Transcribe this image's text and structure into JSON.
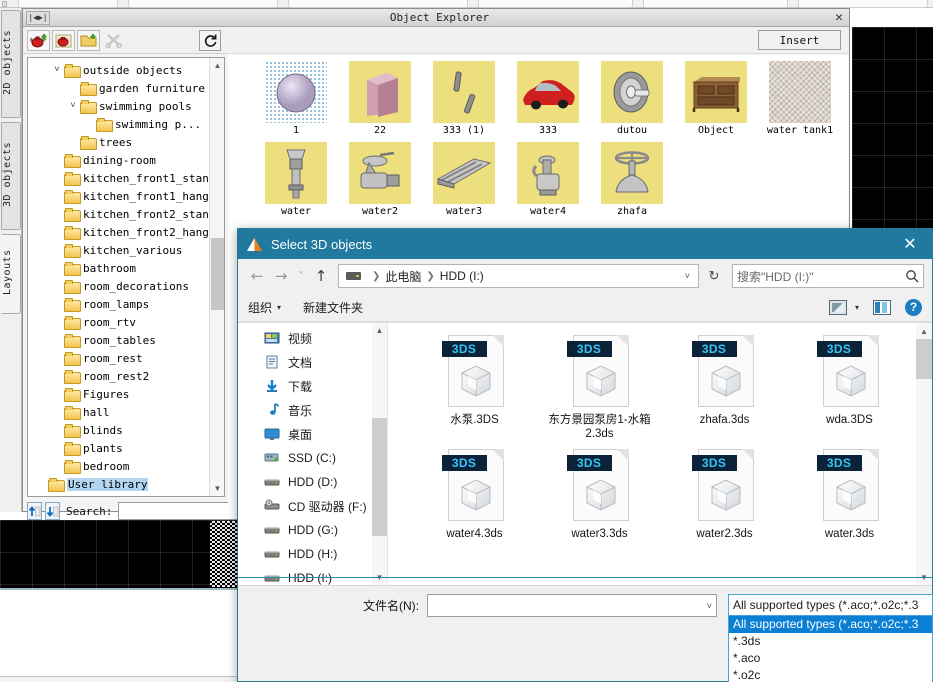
{
  "app": {
    "vertical_tabs": [
      {
        "label": "2D objects",
        "active": false
      },
      {
        "label": "3D objects",
        "active": false
      },
      {
        "label": "Layouts",
        "active": true
      }
    ]
  },
  "object_explorer": {
    "title": "Object Explorer",
    "close_label": "✕",
    "grip_label": "|◀▶|",
    "insert_label": "Insert",
    "toolbar": [
      {
        "name": "add-object-icon",
        "glyph": "🫖",
        "disabled": false
      },
      {
        "name": "edit-object-icon",
        "glyph": "🫖",
        "disabled": false
      },
      {
        "name": "new-folder-icon",
        "glyph": "📁",
        "disabled": false
      },
      {
        "name": "tools-icon",
        "glyph": "✂",
        "disabled": true
      },
      {
        "name": "refresh-icon",
        "glyph": "↻",
        "disabled": false
      }
    ],
    "tree": [
      {
        "label": "outside objects",
        "indent": 1,
        "arrow": "˅",
        "selected": false
      },
      {
        "label": "garden furniture",
        "indent": 2,
        "arrow": "",
        "selected": false
      },
      {
        "label": "swimming pools",
        "indent": 2,
        "arrow": "˅",
        "selected": false
      },
      {
        "label": "swimming p...",
        "indent": 3,
        "arrow": "",
        "selected": false
      },
      {
        "label": "trees",
        "indent": 2,
        "arrow": "",
        "selected": false
      },
      {
        "label": "dining-room",
        "indent": 1,
        "arrow": "",
        "selected": false
      },
      {
        "label": "kitchen_front1_stand",
        "indent": 1,
        "arrow": "",
        "selected": false
      },
      {
        "label": "kitchen_front1_hang",
        "indent": 1,
        "arrow": "",
        "selected": false
      },
      {
        "label": "kitchen_front2_stand",
        "indent": 1,
        "arrow": "",
        "selected": false
      },
      {
        "label": "kitchen_front2_hang",
        "indent": 1,
        "arrow": "",
        "selected": false
      },
      {
        "label": "kitchen_various",
        "indent": 1,
        "arrow": "",
        "selected": false
      },
      {
        "label": "bathroom",
        "indent": 1,
        "arrow": "",
        "selected": false
      },
      {
        "label": "room_decorations",
        "indent": 1,
        "arrow": "",
        "selected": false
      },
      {
        "label": "room_lamps",
        "indent": 1,
        "arrow": "",
        "selected": false
      },
      {
        "label": "room_rtv",
        "indent": 1,
        "arrow": "",
        "selected": false
      },
      {
        "label": "room_tables",
        "indent": 1,
        "arrow": "",
        "selected": false
      },
      {
        "label": "room_rest",
        "indent": 1,
        "arrow": "",
        "selected": false
      },
      {
        "label": "room_rest2",
        "indent": 1,
        "arrow": "",
        "selected": false
      },
      {
        "label": "Figures",
        "indent": 1,
        "arrow": "",
        "selected": false
      },
      {
        "label": "hall",
        "indent": 1,
        "arrow": "",
        "selected": false
      },
      {
        "label": "blinds",
        "indent": 1,
        "arrow": "",
        "selected": false
      },
      {
        "label": "plants",
        "indent": 1,
        "arrow": "",
        "selected": false
      },
      {
        "label": "bedroom",
        "indent": 1,
        "arrow": "",
        "selected": false
      },
      {
        "label": "User library",
        "indent": 0,
        "arrow": "",
        "selected": true
      }
    ],
    "search": {
      "label": "Search:",
      "value": "",
      "placeholder": "",
      "prev_icon": "↑",
      "next_icon": "↓"
    },
    "thumbnails": [
      {
        "label": "1",
        "style": "dotted"
      },
      {
        "label": "22",
        "style": "box"
      },
      {
        "label": "333 (1)",
        "style": "sticks"
      },
      {
        "label": "333",
        "style": "car"
      },
      {
        "label": "dutou",
        "style": "wheel"
      },
      {
        "label": "Object",
        "style": "dresser"
      },
      {
        "label": "water tank1",
        "style": "noise"
      },
      {
        "label": "water",
        "style": "hydrant"
      },
      {
        "label": "water2",
        "style": "valve"
      },
      {
        "label": "water3",
        "style": "rail"
      },
      {
        "label": "water4",
        "style": "pump"
      },
      {
        "label": "zhafa",
        "style": "gate"
      }
    ]
  },
  "file_dialog": {
    "title": "Select 3D objects",
    "close_label": "✕",
    "nav": {
      "back_icon": "←",
      "forward_icon": "→",
      "history_icon": "˅",
      "up_icon": "↑",
      "refresh_icon": "↻",
      "caret_icon": "˅"
    },
    "breadcrumb": [
      "此电脑",
      "HDD (I:)"
    ],
    "search": {
      "placeholder": "搜索\"HDD (I:)\"",
      "value": "",
      "icon": "⌕"
    },
    "commands": {
      "organize": "组织",
      "organize_caret": "▾",
      "new_folder": "新建文件夹",
      "view_caret": "▾",
      "help_label": "?"
    },
    "sidebar": [
      {
        "label": "视频",
        "icon": "videos-icon"
      },
      {
        "label": "文档",
        "icon": "documents-icon"
      },
      {
        "label": "下载",
        "icon": "downloads-icon"
      },
      {
        "label": "音乐",
        "icon": "music-icon"
      },
      {
        "label": "桌面",
        "icon": "desktop-icon"
      },
      {
        "label": "SSD (C:)",
        "icon": "ssd-icon"
      },
      {
        "label": "HDD (D:)",
        "icon": "drive-icon"
      },
      {
        "label": "CD 驱动器 (F:)",
        "icon": "cd-drive-icon"
      },
      {
        "label": "HDD (G:)",
        "icon": "drive-icon"
      },
      {
        "label": "HDD (H:)",
        "icon": "drive-icon"
      },
      {
        "label": "HDD (I:)",
        "icon": "drive-icon"
      }
    ],
    "files": [
      {
        "name": "水泵.3DS",
        "badge": "3DS"
      },
      {
        "name": "东方景园泵房1-水箱2.3ds",
        "badge": "3DS"
      },
      {
        "name": "zhafa.3ds",
        "badge": "3DS"
      },
      {
        "name": "wda.3DS",
        "badge": "3DS"
      },
      {
        "name": "water4.3ds",
        "badge": "3DS"
      },
      {
        "name": "water3.3ds",
        "badge": "3DS"
      },
      {
        "name": "water2.3ds",
        "badge": "3DS"
      },
      {
        "name": "water.3ds",
        "badge": "3DS"
      }
    ],
    "footer": {
      "filename_label": "文件名(N):",
      "filename_value": "",
      "filename_placeholder": "",
      "filename_caret": "˅",
      "filetype_selected": "All supported types (*.aco;*.o2c;*.3",
      "filetype_options": [
        "All supported types (*.aco;*.o2c;*.3",
        "*.3ds",
        "*.aco",
        "*.o2c"
      ]
    }
  },
  "colors": {
    "dialog_titlebar": "#2279a0",
    "selection_blue": "#0a7fd4",
    "tree_selection": "#b4d5f0",
    "thumb_bg": "#eedf7e",
    "badge_bg": "#0b2239",
    "badge_text": "#35c6f4"
  }
}
